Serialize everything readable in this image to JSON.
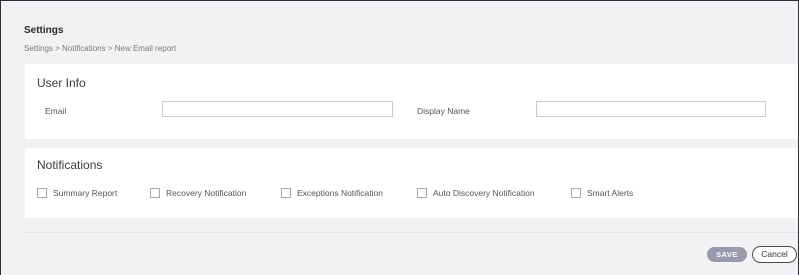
{
  "header": {
    "title": "Settings",
    "breadcrumb": "Settings > Notifications > New Email report"
  },
  "user_info": {
    "title": "User Info",
    "email_label": "Email",
    "email_value": "",
    "display_name_label": "Display Name",
    "display_name_value": ""
  },
  "notifications": {
    "title": "Notifications",
    "options": [
      {
        "label": "Summary Report",
        "checked": false
      },
      {
        "label": "Recovery Notification",
        "checked": false
      },
      {
        "label": "Exceptions Notification",
        "checked": false
      },
      {
        "label": "Auto Discovery Notification",
        "checked": false
      },
      {
        "label": "Smart Alerts",
        "checked": false
      }
    ]
  },
  "actions": {
    "save_label": "SAVE",
    "cancel_label": "Cancel"
  },
  "colors": {
    "page_background": "#f2f2f4",
    "save_button": "#9a9aae",
    "frame_border": "#2b2f36"
  }
}
